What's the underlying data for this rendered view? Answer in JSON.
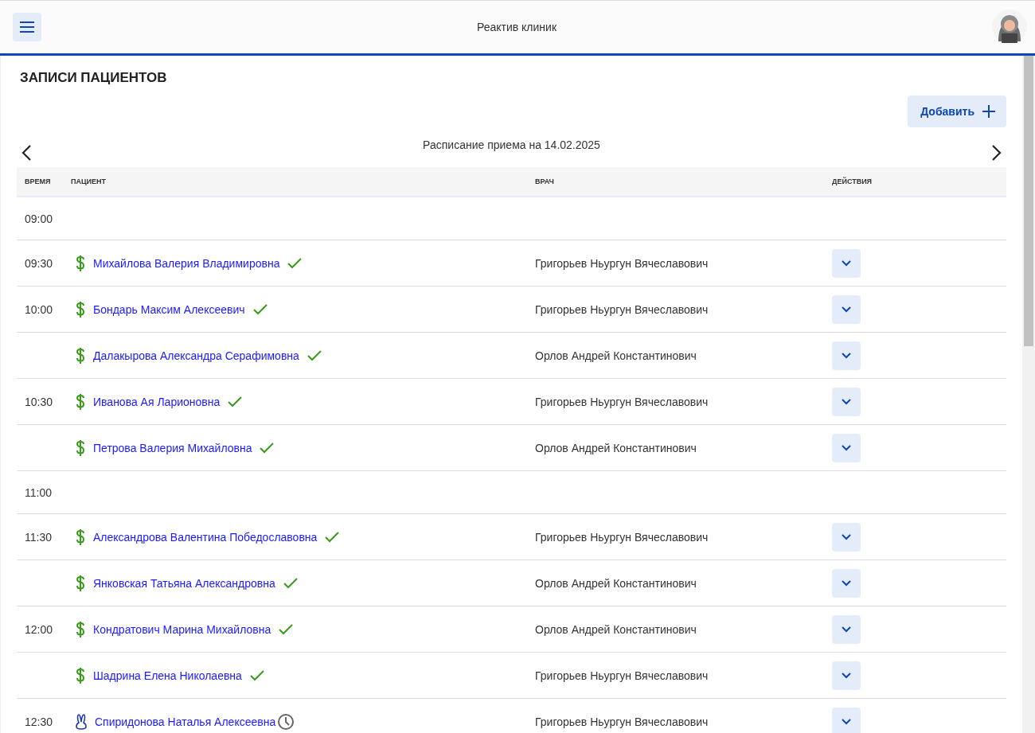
{
  "app_bar": {
    "title": "Реактив клиник"
  },
  "page": {
    "title": "ЗАПИСИ ПАЦИЕНТОВ",
    "add_button": "Добавить",
    "schedule_label": "Расписание приема на 14.02.2025"
  },
  "table": {
    "columns": [
      "ВРЕМЯ",
      "ПАЦИЕНТ",
      "ВРАЧ",
      "ДЕЙСТВИЯ"
    ],
    "rows": [
      {
        "kind": "slot",
        "time": "09:00"
      },
      {
        "kind": "appointment",
        "time": "09:30",
        "paid": true,
        "patient": "Михайлова Валерия Владимировна",
        "confirmed": true,
        "doctor": "Григорьев Ньургун Вячеславович"
      },
      {
        "kind": "appointment",
        "time": "10:00",
        "paid": true,
        "patient": "Бондарь Максим Алексеевич",
        "confirmed": true,
        "doctor": "Григорьев Ньургун Вячеславович"
      },
      {
        "kind": "appointment",
        "paid": true,
        "patient": "Далакырова Александра Серафимовна",
        "confirmed": true,
        "doctor": "Орлов Андрей Константинович"
      },
      {
        "kind": "appointment",
        "time": "10:30",
        "paid": true,
        "patient": "Иванова Ая Ларионовна",
        "confirmed": true,
        "doctor": "Григорьев Ньургун Вячеславович"
      },
      {
        "kind": "appointment",
        "paid": true,
        "patient": "Петрова Валерия Михайловна",
        "confirmed": true,
        "doctor": "Орлов Андрей Константинович"
      },
      {
        "kind": "slot",
        "time": "11:00"
      },
      {
        "kind": "appointment",
        "time": "11:30",
        "paid": true,
        "patient": "Александрова Валентина Победославовна",
        "confirmed": true,
        "doctor": "Григорьев Ньургун Вячеславович"
      },
      {
        "kind": "appointment",
        "paid": true,
        "patient": "Янковская Татьяна Александровна",
        "confirmed": true,
        "doctor": "Орлов Андрей Константинович"
      },
      {
        "kind": "appointment",
        "time": "12:00",
        "paid": true,
        "patient": "Кондратович Марина Михайловна",
        "confirmed": true,
        "doctor": "Орлов Андрей Константинович"
      },
      {
        "kind": "appointment",
        "paid": true,
        "patient": "Шадрина Елена Николаевна",
        "confirmed": true,
        "doctor": "Григорьев Ньургун Вячеславович"
      },
      {
        "kind": "appointment",
        "time": "12:30",
        "paid": false,
        "patient": "Спиридонова Наталья Алексеевна",
        "confirmed": false,
        "doctor": "Григорьев Ньургун Вячеславович"
      }
    ]
  }
}
